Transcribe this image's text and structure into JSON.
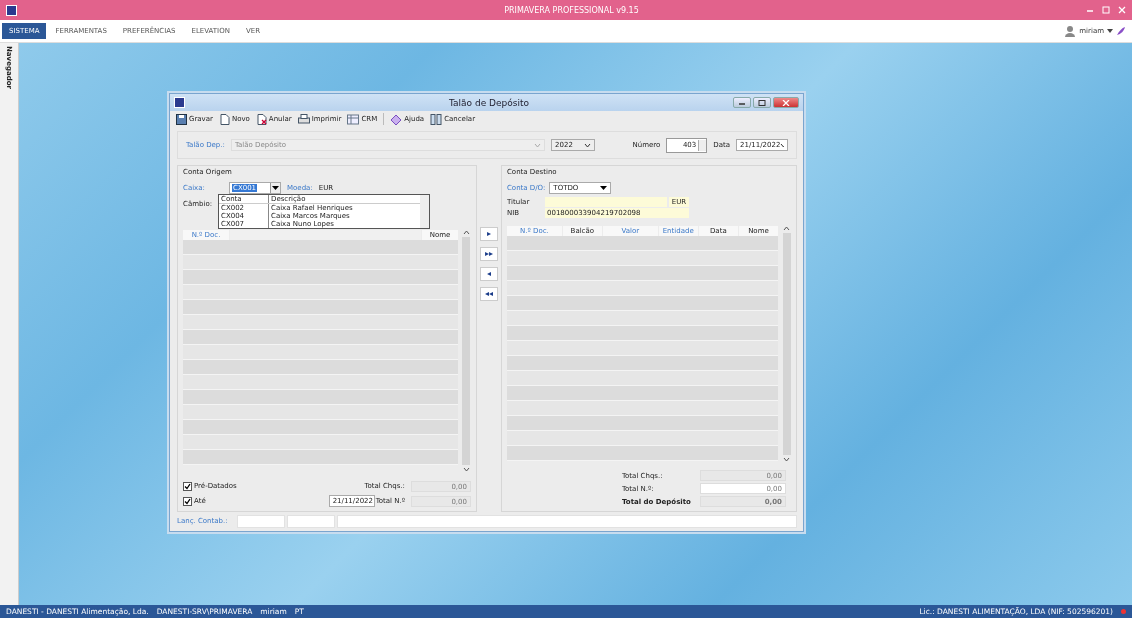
{
  "app": {
    "title": "PRIMAVERA PROFESSIONAL v9.15"
  },
  "menu": [
    {
      "label": "SISTEMA",
      "selected": true
    },
    {
      "label": "FERRAMENTAS",
      "selected": false
    },
    {
      "label": "PREFERÊNCIAS",
      "selected": false
    },
    {
      "label": "ELEVATION",
      "selected": false
    },
    {
      "label": "VER",
      "selected": false
    }
  ],
  "user": {
    "name": "miriam"
  },
  "sidebar": {
    "label": "Navegador"
  },
  "dialog": {
    "title": "Talão de Depósito",
    "toolbar": [
      {
        "label": "Gravar"
      },
      {
        "label": "Novo"
      },
      {
        "label": "Anular"
      },
      {
        "label": "Imprimir"
      },
      {
        "label": "CRM"
      },
      {
        "label": "Ajuda"
      },
      {
        "label": "Cancelar"
      }
    ],
    "talao_label": "Talão Dep.:",
    "talao_value": "Talão Depósito",
    "year": "2022",
    "numero_label": "Número",
    "numero": "403",
    "data_label": "Data",
    "data": "21/11/2022",
    "origem": {
      "title": "Conta Origem",
      "caixa_label": "Caixa:",
      "caixa": "CX001",
      "moeda_label": "Moeda:",
      "moeda": "EUR",
      "cambio_label": "Câmbio:",
      "columns": [
        "N.º Doc.",
        "Nome"
      ],
      "dropdown": {
        "columns": [
          "Conta",
          "Descrição"
        ],
        "rows": [
          [
            "CX002",
            "Caixa Rafael Henriques"
          ],
          [
            "CX004",
            "Caixa Marcos Marques"
          ],
          [
            "CX007",
            "Caixa Nuno Lopes"
          ]
        ]
      },
      "pre_datados": {
        "label": "Pré-Datados",
        "checked": true
      },
      "ate": {
        "label": "Até",
        "checked": true,
        "date": "21/11/2022"
      },
      "totals": [
        {
          "label": "Total Chqs.:",
          "value": "0,00"
        },
        {
          "label": "Total N.º",
          "value": "0,00"
        }
      ]
    },
    "move_buttons": [
      "▸",
      "▸▸",
      "◂",
      "◂◂"
    ],
    "destino": {
      "title": "Conta Destino",
      "conta_label": "Conta D/O:",
      "conta": "TOTDO",
      "titular_label": "Titular",
      "moeda": "EUR",
      "nib_label": "NIB",
      "nib": "001800033904219702098",
      "columns": [
        "N.º Doc.",
        "Balcão",
        "Valor",
        "Entidade",
        "Data",
        "Nome"
      ],
      "totals": [
        {
          "label": "Total Chqs.:",
          "value": "0,00",
          "kind": "readonly"
        },
        {
          "label": "Total N.º:",
          "value": "0,00",
          "kind": "input"
        },
        {
          "label": "Total do Depósito",
          "value": "0,00",
          "kind": "total"
        }
      ]
    },
    "lanc_label": "Lanç. Contab.:"
  },
  "status": {
    "left": [
      "DANESTI - DANESTI Alimentação, Lda.",
      "DANESTI-SRV\\PRIMAVERA",
      "miriam",
      "PT"
    ],
    "right": "Lic.: DANESTI ALIMENTAÇÃO, LDA (NIF: 502596201)"
  }
}
